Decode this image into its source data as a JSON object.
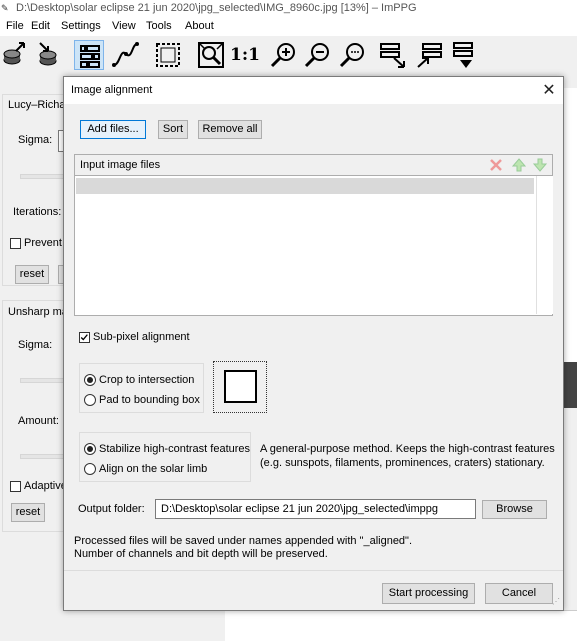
{
  "window": {
    "title": "D:\\Desktop\\solar eclipse 21 jun 2020\\jpg_selected\\IMG_8960c.jpg [13%] – ImPPG"
  },
  "menu": [
    "File",
    "Edit",
    "Settings",
    "View",
    "Tools",
    "About"
  ],
  "toolbar": {
    "icons": [
      "load-settings",
      "save-settings",
      "processing-settings",
      "tone-curve",
      "select-region",
      "fit-window",
      "actual-size",
      "zoom-in",
      "zoom-out",
      "custom-zoom",
      "align-horizontal",
      "align-vertical",
      "align-images"
    ],
    "one_to_one_label": "1:1"
  },
  "left_panel": {
    "lucy_label": "Lucy–Richa",
    "sigma_label": "Sigma:",
    "iterations_label": "Iterations:",
    "prevent_label": "Prevent",
    "reset_label": "reset",
    "unsharp_label": "Unsharp ma",
    "sigma2_label": "Sigma:",
    "amount_label": "Amount:",
    "adaptive_label": "Adaptive",
    "reset2_label": "reset"
  },
  "dialog": {
    "title": "Image alignment",
    "add_files": "Add files...",
    "sort": "Sort",
    "remove_all": "Remove all",
    "list_header": "Input image files",
    "subpixel_label": "Sub-pixel alignment",
    "subpixel_checked": true,
    "crop_label": "Crop to intersection",
    "pad_label": "Pad to bounding box",
    "stabilize_label": "Stabilize high-contrast features",
    "solar_limb_label": "Align on the solar limb",
    "method_desc_1": "A general-purpose method. Keeps the high-contrast features",
    "method_desc_2": "(e.g. sunspots, filaments, prominences, craters) stationary.",
    "output_label": "Output folder:",
    "output_value": "D:\\Desktop\\solar eclipse 21 jun 2020\\jpg_selected\\imppg",
    "browse": "Browse",
    "info_1": "Processed files will be saved under names appended with \"_aligned\".",
    "info_2": "Number of channels and bit depth will be preserved.",
    "start": "Start processing",
    "cancel": "Cancel"
  }
}
